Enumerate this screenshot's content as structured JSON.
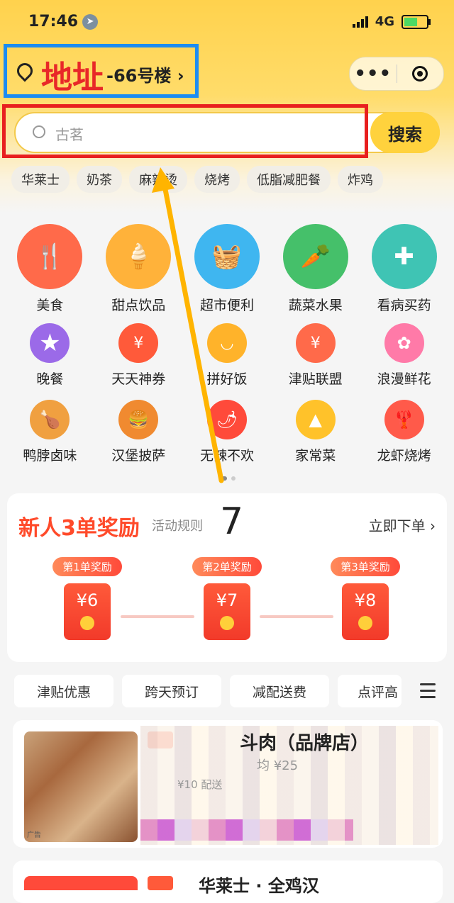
{
  "status": {
    "time": "17:46",
    "network": "4G"
  },
  "header": {
    "address_annotation": "地址",
    "address": "-66号楼 ›",
    "more_icon": "•••"
  },
  "search": {
    "placeholder": "古茗",
    "button": "搜索"
  },
  "chips": [
    "华莱士",
    "奶茶",
    "麻辣烫",
    "烧烤",
    "低脂减肥餐",
    "炸鸡"
  ],
  "categories": [
    [
      {
        "label": "美食",
        "icon": "utensils-icon",
        "color": "#ff6a4a"
      },
      {
        "label": "甜点饮品",
        "icon": "ice-cream-icon",
        "color": "#ffb23a"
      },
      {
        "label": "超市便利",
        "icon": "basket-icon",
        "color": "#3fb6f0"
      },
      {
        "label": "蔬菜水果",
        "icon": "carrot-icon",
        "color": "#45c06a"
      },
      {
        "label": "看病买药",
        "icon": "medkit-icon",
        "color": "#3fc4b4"
      }
    ],
    [
      {
        "label": "晚餐",
        "icon": "cloche-icon",
        "color": "#9b6ae8"
      },
      {
        "label": "天天神券",
        "icon": "coupon-icon",
        "color": "#ff5a3a"
      },
      {
        "label": "拼好饭",
        "icon": "bowl-icon",
        "color": "#ffb32a"
      },
      {
        "label": "津贴联盟",
        "icon": "money-bag-icon",
        "color": "#ff6a4a"
      },
      {
        "label": "浪漫鲜花",
        "icon": "flower-icon",
        "color": "#ff7aa8"
      }
    ],
    [
      {
        "label": "鸭脖卤味",
        "icon": "drumstick-icon",
        "color": "#f0a040"
      },
      {
        "label": "汉堡披萨",
        "icon": "burger-icon",
        "color": "#f08a30"
      },
      {
        "label": "无辣不欢",
        "icon": "chili-icon",
        "color": "#ff4a3a"
      },
      {
        "label": "家常菜",
        "icon": "dish-icon",
        "color": "#ffc22a"
      },
      {
        "label": "龙虾烧烤",
        "icon": "lobster-icon",
        "color": "#ff5a4a"
      }
    ]
  ],
  "promo": {
    "title": "新人3单奖励",
    "rules": "活动规则",
    "number": "7",
    "order_now": "立即下单 ›",
    "rewards": [
      {
        "badge": "第1单奖励",
        "amount": "¥6"
      },
      {
        "badge": "第2单奖励",
        "amount": "¥7"
      },
      {
        "badge": "第3单奖励",
        "amount": "¥8"
      }
    ]
  },
  "filter_tabs": [
    "津贴优惠",
    "跨天预订",
    "减配送费",
    "点评高"
  ],
  "shops": [
    {
      "name": "斗肉（品牌店）",
      "price": "均 ¥25",
      "delivery": "¥10 配送",
      "ad": "广告"
    },
    {
      "name": "华莱士 · 全鸡汉"
    }
  ]
}
